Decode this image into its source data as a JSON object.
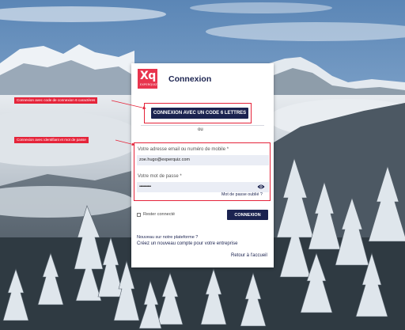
{
  "colors": {
    "brand": "#e8354e",
    "primary": "#1b2350",
    "annotation": "#e5243a",
    "input_bg": "#eaedf5"
  },
  "logo": {
    "main": "Xq",
    "sub": "EXPERQUIZ"
  },
  "card": {
    "title": "Connexion",
    "code_button": "CONNEXION AVEC UN CODE 6 LETTRES",
    "or": "ou",
    "email_label": "Votre adresse email ou numéro de mobile *",
    "email_value": "zoe.hugo@experquiz.com",
    "password_label": "Votre mot de passe *",
    "password_value": "•••••••••••",
    "forgot": "Mot de passe oublié ?",
    "remember": "Rester connecté",
    "login_button": "CONNEXION",
    "new_platform": "Nouveau sur notre plateforme ?",
    "create_account": "Créez un nouveau compte pour votre entreprise",
    "back_home": "Retour à l'accueil"
  },
  "annotations": {
    "code": "Connexion avec code de connexion 6 caractères",
    "credentials": "Connexion avec identifiant et mot de passe"
  }
}
